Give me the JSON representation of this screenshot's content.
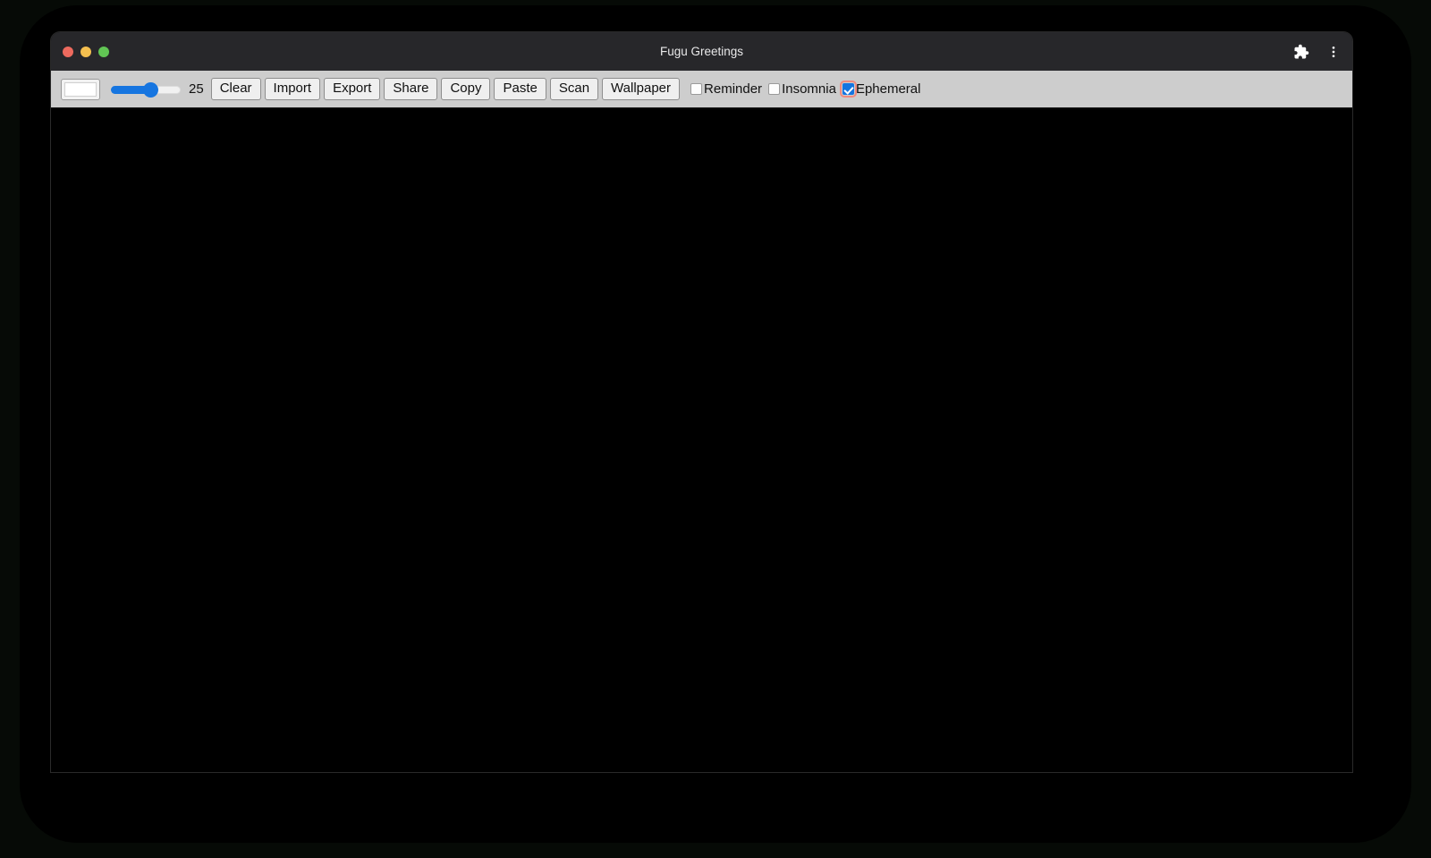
{
  "window": {
    "title": "Fugu Greetings",
    "traffic_lights": [
      {
        "name": "close",
        "color": "#ed6a5e"
      },
      {
        "name": "minimize",
        "color": "#f4bf4f"
      },
      {
        "name": "maximize",
        "color": "#61c554"
      }
    ],
    "actions": [
      {
        "name": "extensions-icon",
        "glyph": "puzzle"
      },
      {
        "name": "more-menu-icon",
        "glyph": "kebab"
      }
    ]
  },
  "toolbar": {
    "color_picker": {
      "label": "color-picker",
      "value": "#ffffff"
    },
    "slider": {
      "label": "line-width",
      "value": "25",
      "min": "1",
      "max": "50",
      "percent": 52,
      "accent": "#1675e0"
    },
    "buttons": [
      {
        "label": "Clear",
        "name": "clear-button"
      },
      {
        "label": "Import",
        "name": "import-button"
      },
      {
        "label": "Export",
        "name": "export-button"
      },
      {
        "label": "Share",
        "name": "share-button"
      },
      {
        "label": "Copy",
        "name": "copy-button"
      },
      {
        "label": "Paste",
        "name": "paste-button"
      },
      {
        "label": "Scan",
        "name": "scan-button"
      },
      {
        "label": "Wallpaper",
        "name": "wallpaper-button"
      }
    ],
    "checkboxes": [
      {
        "label": "Reminder",
        "name": "reminder-checkbox",
        "checked": false,
        "focused": false
      },
      {
        "label": "Insomnia",
        "name": "insomnia-checkbox",
        "checked": false,
        "focused": false
      },
      {
        "label": "Ephemeral",
        "name": "ephemeral-checkbox",
        "checked": true,
        "focused": true
      }
    ],
    "background": "#cdcdcd"
  },
  "canvas": {
    "name": "drawing-canvas",
    "background": "#000000"
  }
}
